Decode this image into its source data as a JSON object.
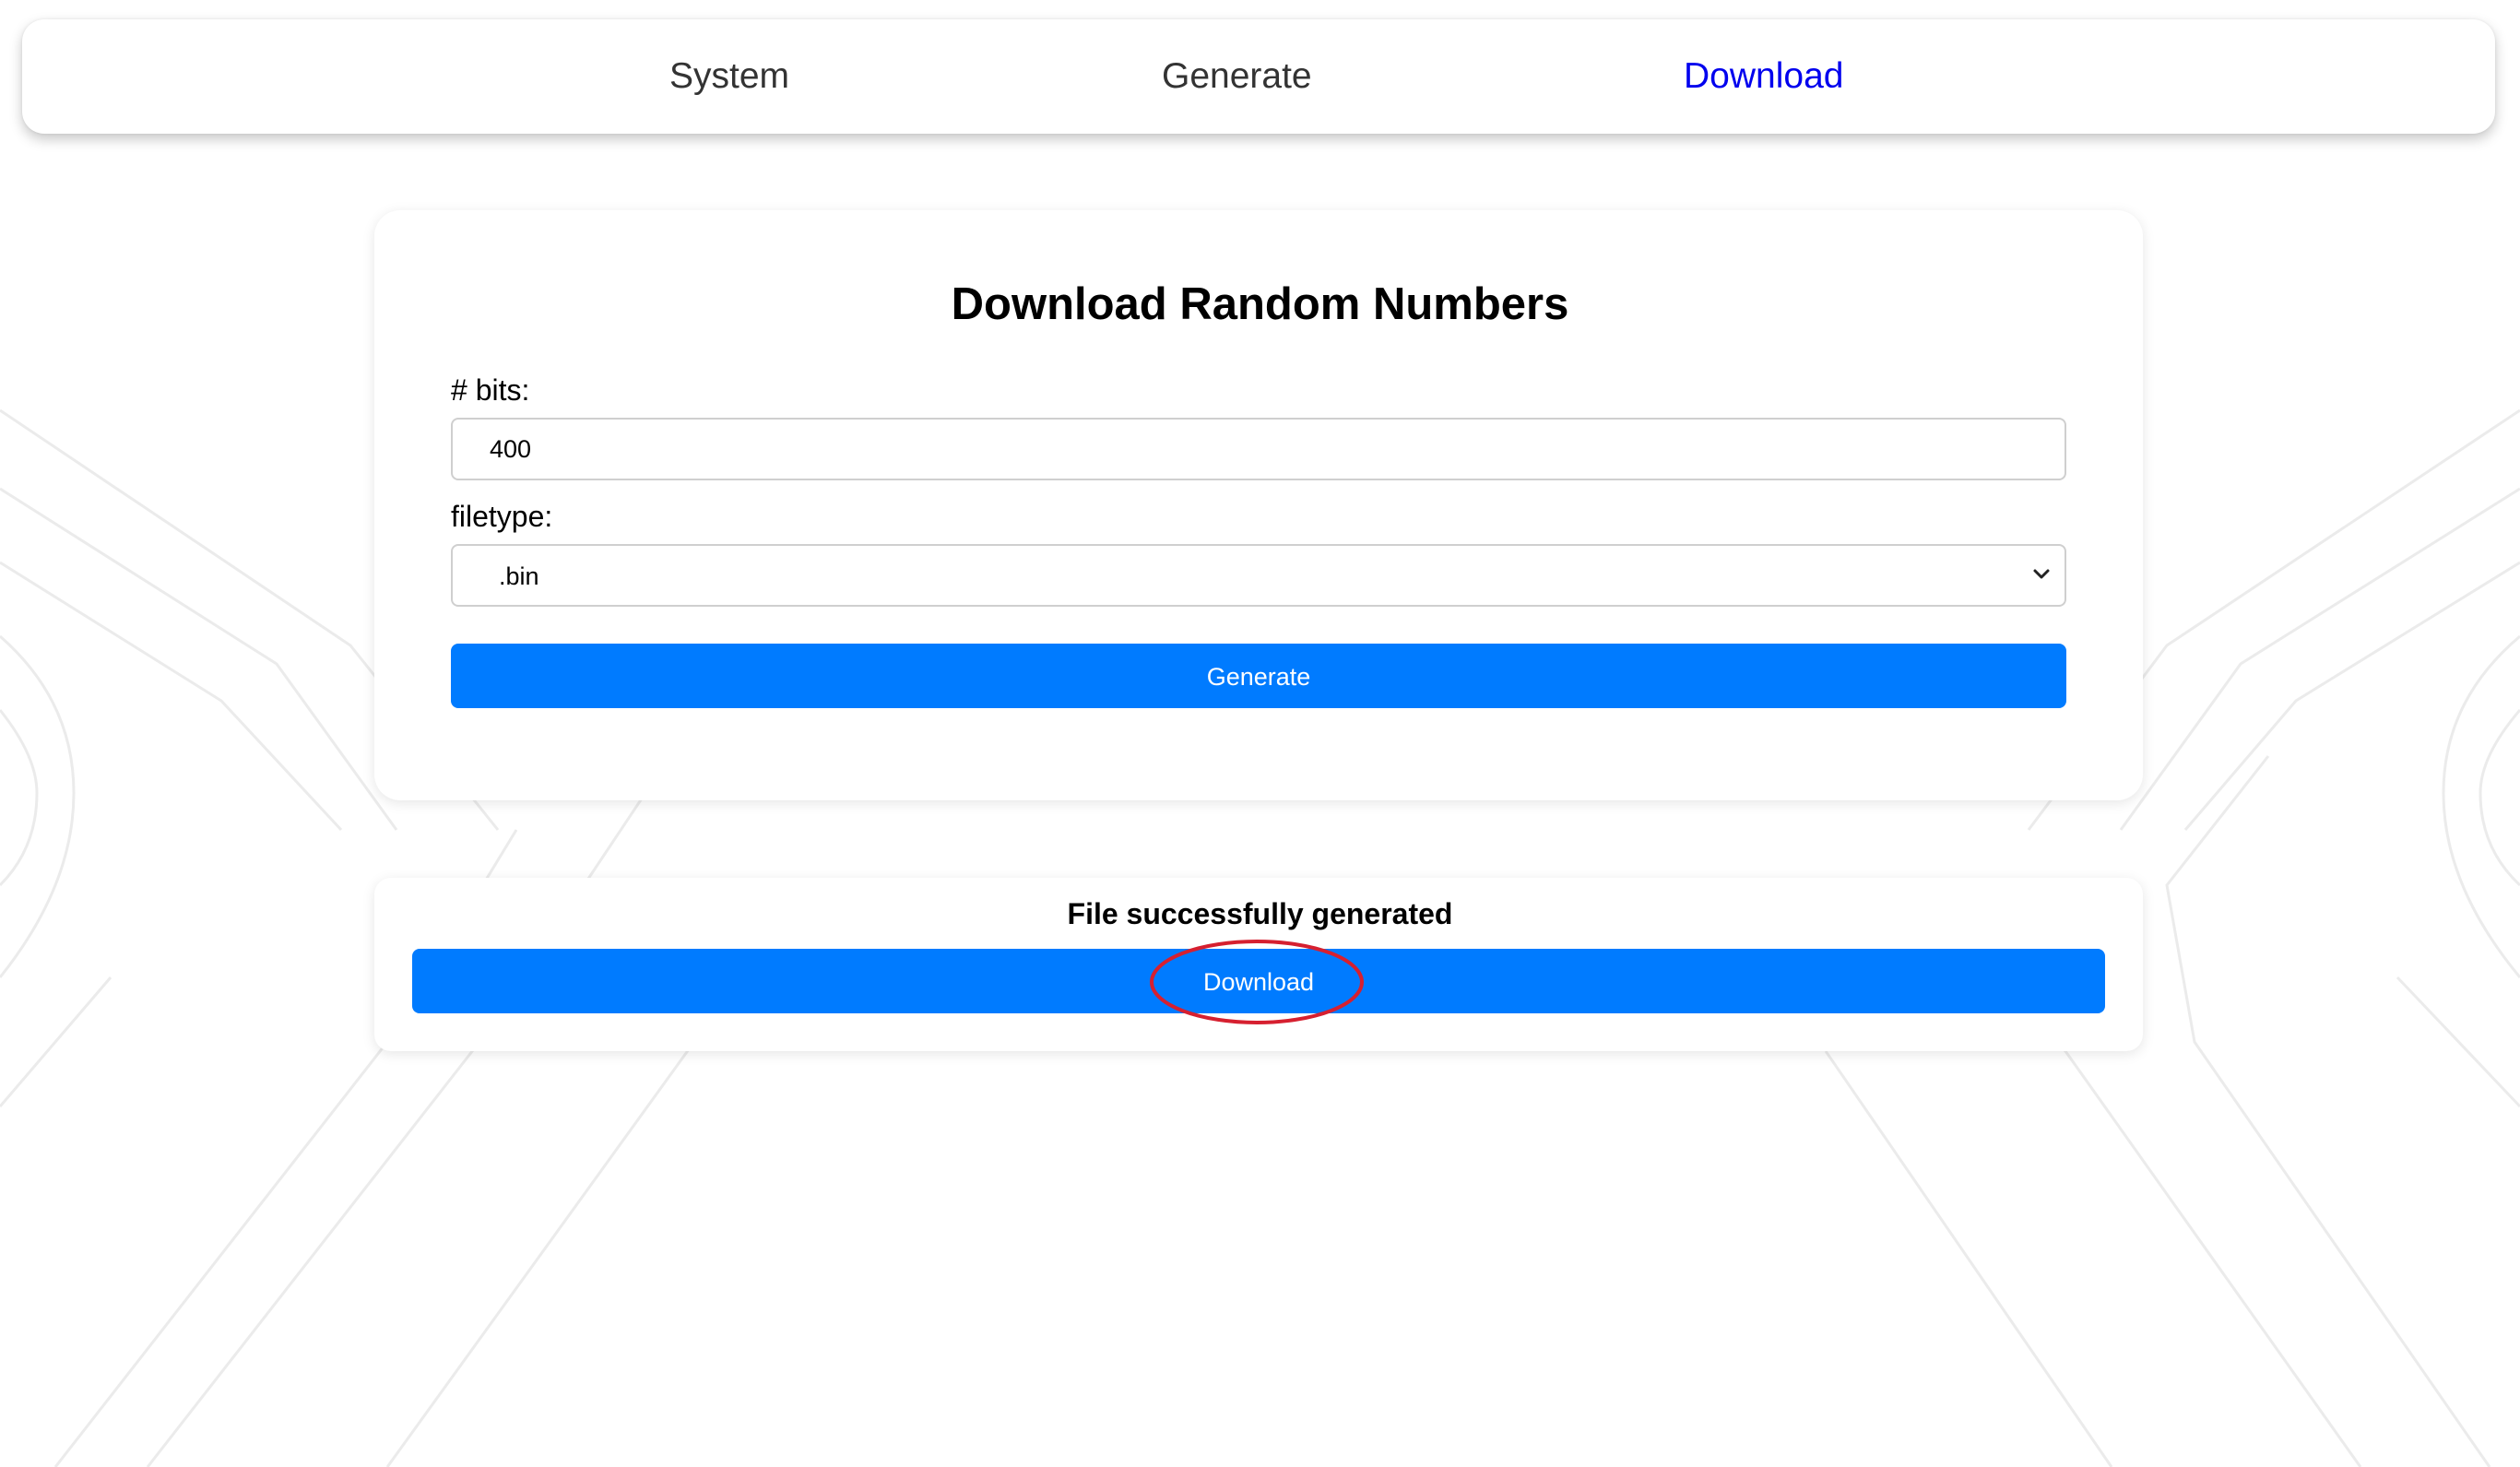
{
  "nav": {
    "items": [
      {
        "label": "System",
        "active": false
      },
      {
        "label": "Generate",
        "active": false
      },
      {
        "label": "Download",
        "active": true
      }
    ],
    "active_color": "#0000ee"
  },
  "form": {
    "title": "Download Random Numbers",
    "bits_label": "# bits:",
    "bits_value": "400",
    "filetype_label": "filetype:",
    "filetype_selected": ".bin",
    "generate_label": "Generate"
  },
  "result": {
    "message": "File successfully generated",
    "download_label": "Download"
  },
  "colors": {
    "accent": "#007bff",
    "annotation": "#d62030"
  }
}
